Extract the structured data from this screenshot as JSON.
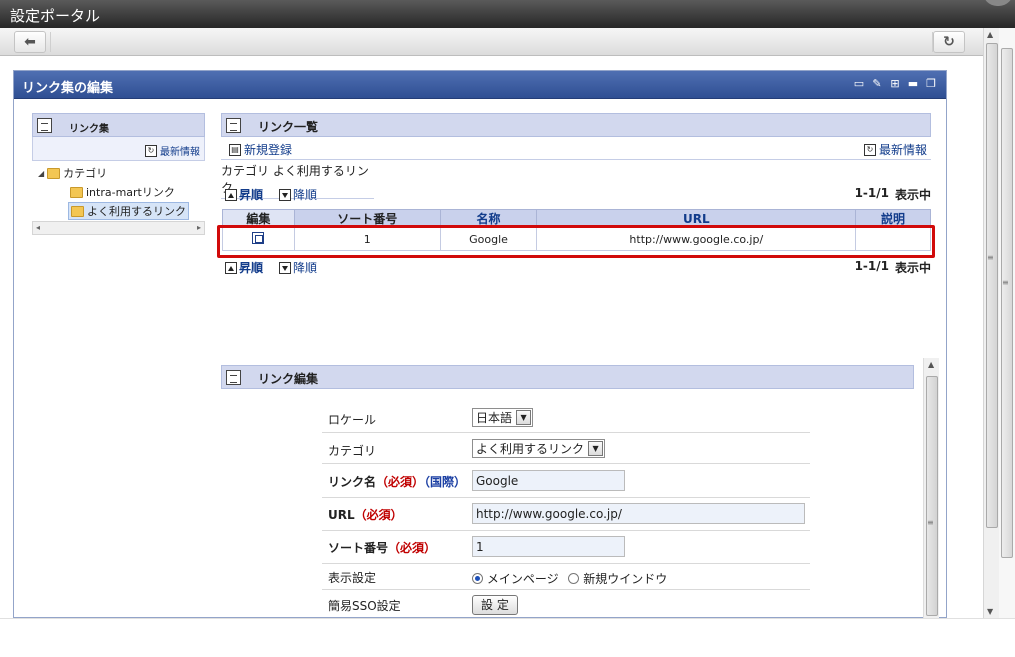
{
  "window": {
    "title": "設定ポータル"
  },
  "portlet": {
    "title": "リンク集の編集"
  },
  "left_panel": {
    "header": "リンク集",
    "latest": "最新情報",
    "tree": [
      {
        "label": "カテゴリ",
        "level": 0,
        "expanded": true
      },
      {
        "label": "intra-martリンク",
        "level": 1
      },
      {
        "label": "よく利用するリンク",
        "level": 1,
        "selected": true
      }
    ]
  },
  "link_list": {
    "header": "リンク一覧",
    "new_label": "新規登録",
    "latest_label": "最新情報",
    "breadcrumb": "カテゴリ よく利用するリンク",
    "sort_asc": "昇順",
    "sort_desc": "降順",
    "count": "1-1/1",
    "showing": "表示中",
    "columns": [
      "編集",
      "ソート番号",
      "名称",
      "URL",
      "説明"
    ],
    "rows": [
      {
        "sort": "1",
        "name": "Google",
        "url": "http://www.google.co.jp/",
        "desc": ""
      }
    ]
  },
  "link_edit": {
    "header": "リンク編集",
    "locale_label": "ロケール",
    "locale_value": "日本語",
    "category_label": "カテゴリ",
    "category_value": "よく利用するリンク",
    "name_label": "リンク名",
    "name_required": "（必須）",
    "name_intl": "（国際）",
    "name_value": "Google",
    "url_label": "URL",
    "url_required": "（必須）",
    "url_value": "http://www.google.co.jp/",
    "sort_label": "ソート番号",
    "sort_required": "（必須）",
    "sort_value": "1",
    "display_label": "表示設定",
    "display_options": [
      "メインページ",
      "新規ウインドウ"
    ],
    "display_selected": "メインページ",
    "sso_label": "簡易SSO設定",
    "sso_button": "設 定"
  },
  "colors": {
    "highlight": "#d10a0a",
    "header_bg": "#2f4f93",
    "accent_link": "#123c8b"
  }
}
